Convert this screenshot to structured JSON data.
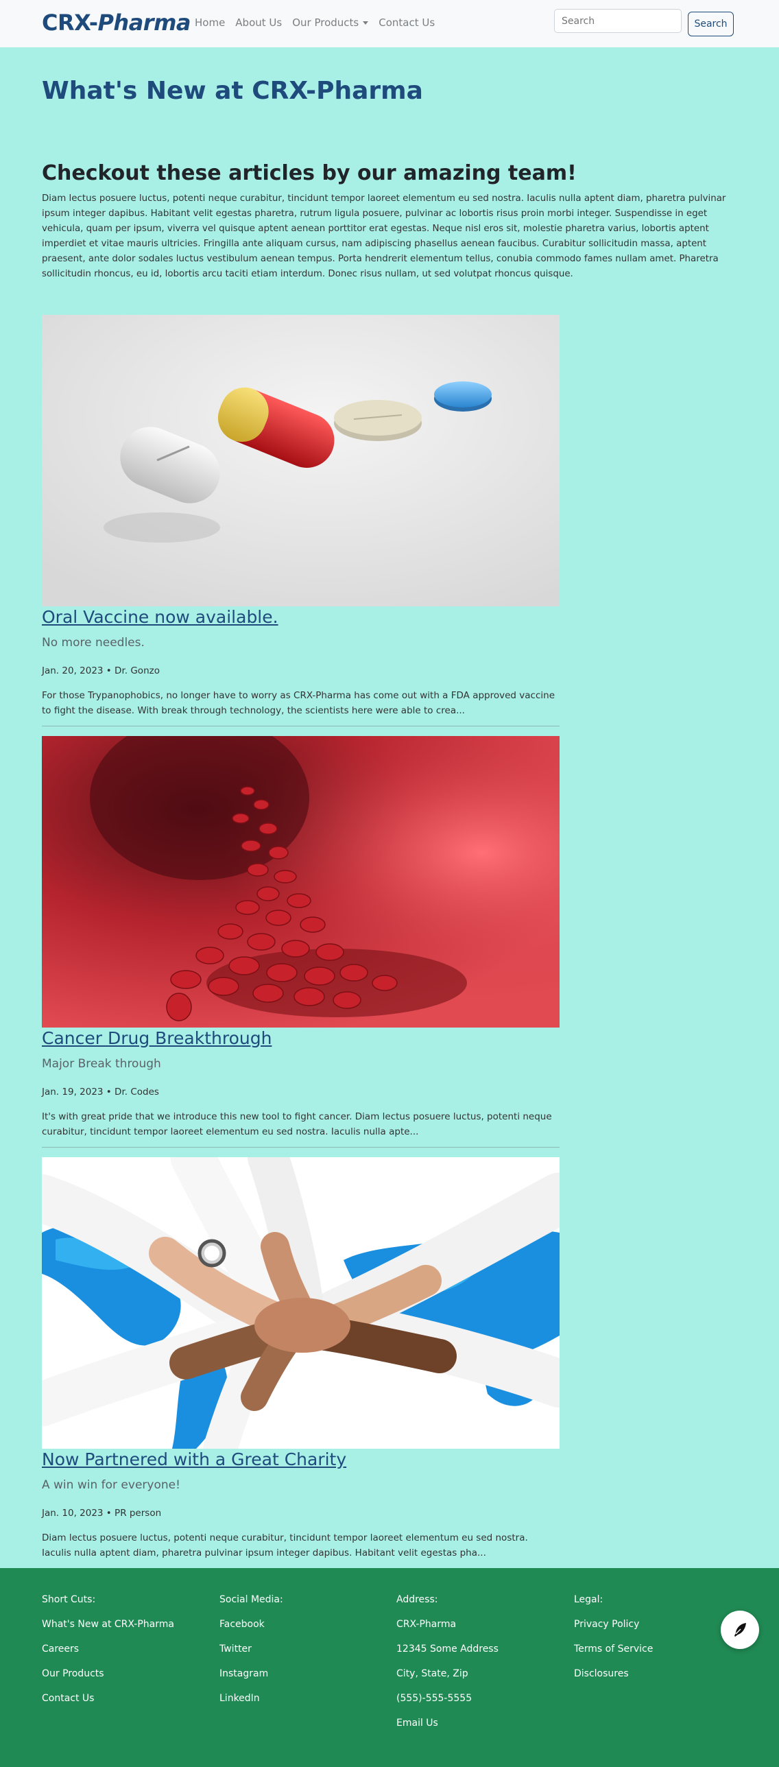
{
  "navbar": {
    "brand_part1": "CRX-",
    "brand_part2": "Pharma",
    "links": [
      "Home",
      "About Us",
      "Our Products",
      "Contact Us"
    ],
    "search_placeholder": "Search",
    "search_button": "Search"
  },
  "main": {
    "page_title": "What's New at CRX-Pharma",
    "section_title": "Checkout these articles by our amazing team!",
    "intro": "Diam lectus posuere luctus, potenti neque curabitur, tincidunt tempor laoreet elementum eu sed nostra. Iaculis nulla aptent diam, pharetra pulvinar ipsum integer dapibus. Habitant velit egestas pharetra, rutrum ligula posuere, pulvinar ac lobortis risus proin morbi integer. Suspendisse in eget vehicula, quam per ipsum, viverra vel quisque aptent aenean porttitor erat egestas. Neque nisl eros sit, molestie pharetra varius, lobortis aptent imperdiet et vitae mauris ultricies. Fringilla ante aliquam cursus, nam adipiscing phasellus aenean faucibus. Curabitur sollicitudin massa, aptent praesent, ante dolor sodales luctus vestibulum aenean tempus. Porta hendrerit elementum tellus, conubia commodo fames nullam amet. Pharetra sollicitudin rhoncus, eu id, lobortis arcu taciti etiam interdum. Donec risus nullam, ut sed volutpat rhoncus quisque."
  },
  "articles": [
    {
      "title": "Oral Vaccine now available.",
      "subtitle": "No more needles.",
      "meta": "Jan. 20, 2023 • Dr. Gonzo",
      "excerpt": "For those Trypanophobics, no longer have to worry as CRX-Pharma has come out with a FDA approved vaccine to fight the disease. With break through technology, the scientists here were able to crea..."
    },
    {
      "title": "Cancer Drug Breakthrough",
      "subtitle": "Major Break through",
      "meta": "Jan. 19, 2023 • Dr. Codes",
      "excerpt": "It's with great pride that we introduce this new tool to fight cancer. Diam lectus posuere luctus, potenti neque curabitur, tincidunt tempor laoreet elementum eu sed nostra. Iaculis nulla apte..."
    },
    {
      "title": "Now Partnered with a Great Charity",
      "subtitle": "A win win for everyone!",
      "meta": "Jan. 10, 2023 • PR person",
      "excerpt": "Diam lectus posuere luctus, potenti neque curabitur, tincidunt tempor laoreet elementum eu sed nostra. Iaculis nulla aptent diam, pharetra pulvinar ipsum integer dapibus. Habitant velit egestas pha..."
    }
  ],
  "footer": {
    "shortcuts": {
      "heading": "Short Cuts:",
      "items": [
        "What's New at CRX-Pharma",
        "Careers",
        "Our Products",
        "Contact Us"
      ]
    },
    "social": {
      "heading": "Social Media:",
      "items": [
        "Facebook",
        "Twitter",
        "Instagram",
        "LinkedIn"
      ]
    },
    "address": {
      "heading": "Address:",
      "items": [
        "CRX-Pharma",
        "12345 Some Address",
        "City, State, Zip",
        "(555)-555-5555",
        "Email Us"
      ]
    },
    "legal": {
      "heading": "Legal:",
      "items": [
        "Privacy Policy",
        "Terms of Service",
        "Disclosures"
      ]
    }
  },
  "icons": {
    "fab": "feather-pen-icon"
  },
  "colors": {
    "background": "#a8f0e6",
    "brand": "#1e4b7c",
    "footer": "#208a54"
  }
}
